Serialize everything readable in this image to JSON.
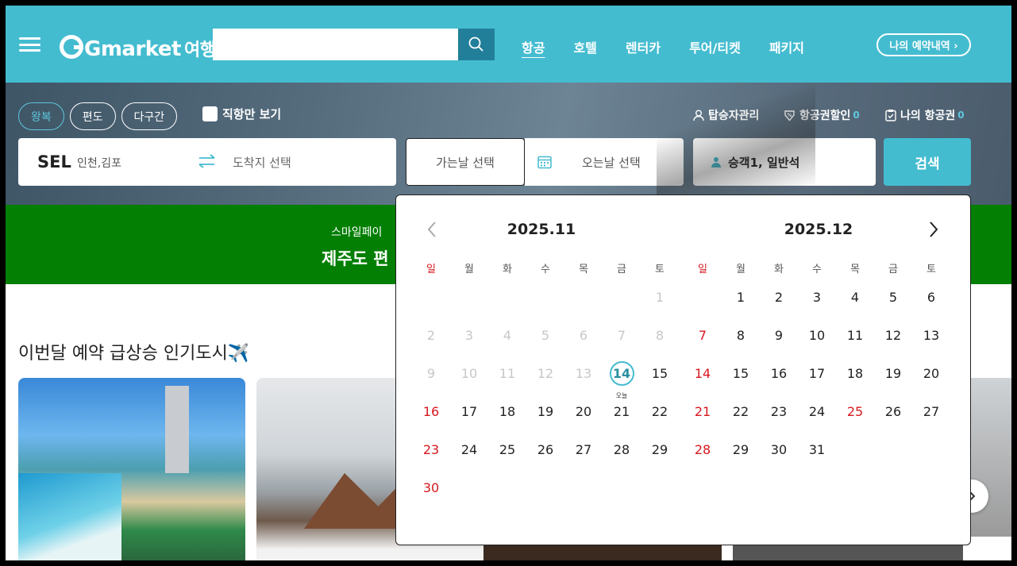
{
  "header": {
    "brand": "Gmarket",
    "brand_suffix": "여행",
    "nav": [
      "항공",
      "호텔",
      "렌터카",
      "투어/티켓",
      "패키지"
    ],
    "my_reservations": "나의 예약내역 ›"
  },
  "search": {
    "trip_types": [
      "왕복",
      "편도",
      "다구간"
    ],
    "direct_only": "직항만 보기",
    "passenger_mgmt": "탑승자관리",
    "discount": "항공권할인",
    "discount_count": "0",
    "my_tickets": "나의 항공권",
    "my_tickets_count": "0",
    "origin_code": "SEL",
    "origin_city": "인천,김포",
    "destination_placeholder": "도착지 선택",
    "depart_placeholder": "가는날 선택",
    "return_placeholder": "오는날 선택",
    "passengers": "승객1, 일반석",
    "search_button": "검색"
  },
  "banner": {
    "subtitle": "스마일페이",
    "title": "제주도 편"
  },
  "popular": {
    "title": "이번달 예약 급상승 인기도시✈️"
  },
  "calendar": {
    "weekdays": [
      "일",
      "월",
      "화",
      "수",
      "목",
      "금",
      "토"
    ],
    "today_label": "오늘",
    "months": [
      {
        "title": "2025.11",
        "days": [
          "",
          "",
          "",
          "",
          "",
          "",
          "1",
          "2",
          "3",
          "4",
          "5",
          "6",
          "7",
          "8",
          "9",
          "10",
          "11",
          "12",
          "13",
          "14",
          "15",
          "16",
          "17",
          "18",
          "19",
          "20",
          "21",
          "22",
          "23",
          "24",
          "25",
          "26",
          "27",
          "28",
          "29",
          "30"
        ],
        "past_until": 13,
        "today": 14,
        "red_days": [
          16,
          23,
          30
        ]
      },
      {
        "title": "2025.12",
        "days": [
          "",
          "1",
          "2",
          "3",
          "4",
          "5",
          "6",
          "7",
          "8",
          "9",
          "10",
          "11",
          "12",
          "13",
          "14",
          "15",
          "16",
          "17",
          "18",
          "19",
          "20",
          "21",
          "22",
          "23",
          "24",
          "25",
          "26",
          "27",
          "28",
          "29",
          "30",
          "31"
        ],
        "past_until": 0,
        "today": 0,
        "red_days": [
          7,
          14,
          21,
          25,
          28
        ]
      }
    ]
  },
  "colors": {
    "accent": "#44bcd0",
    "banner": "#037f04",
    "holiday": "#d6181e"
  }
}
